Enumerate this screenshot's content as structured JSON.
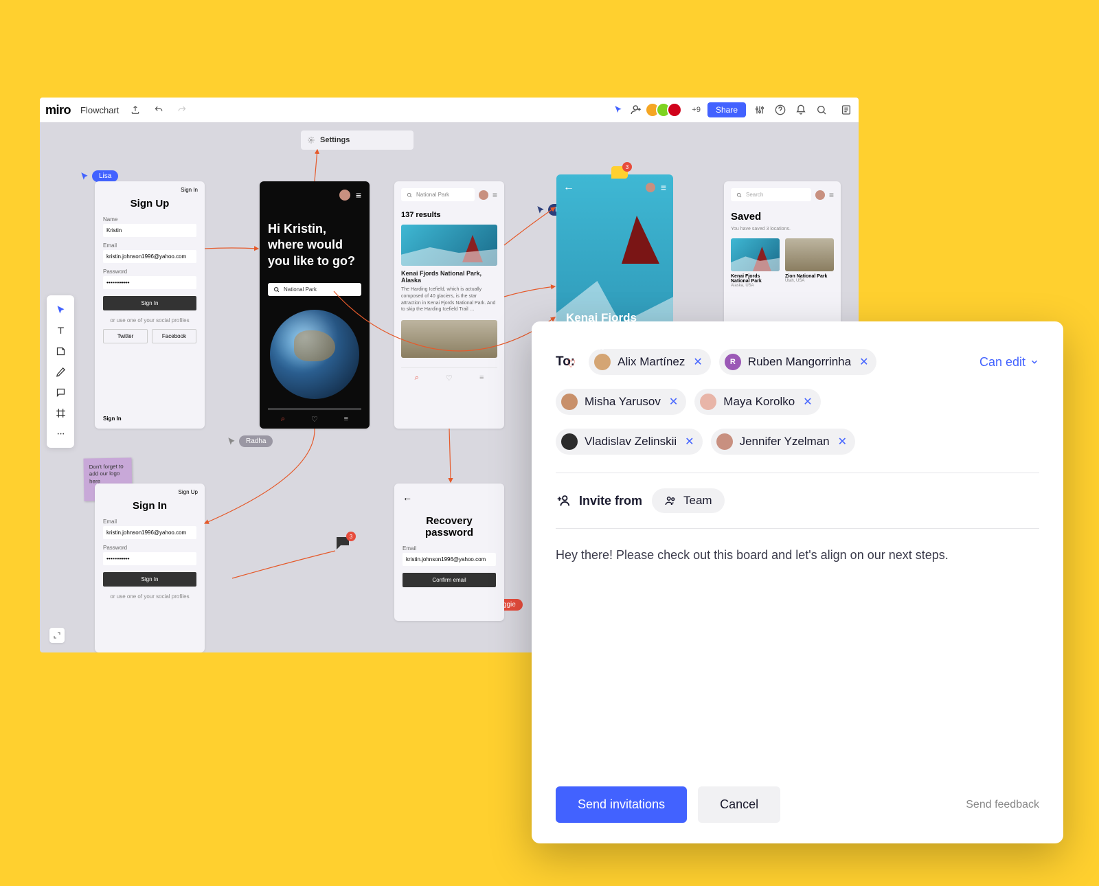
{
  "app": {
    "logo": "miro",
    "board_name": "Flowchart"
  },
  "topbar": {
    "share": "Share",
    "plus_count": "+9"
  },
  "settings": {
    "label": "Settings"
  },
  "cursors": {
    "lisa": "Lisa",
    "radha": "Radha",
    "maggie": "Maggie",
    "igor": "Igor"
  },
  "sticky": {
    "text": "Don't forget to add our logo here"
  },
  "mockups": {
    "signup": {
      "corner": "Sign In",
      "title": "Sign Up",
      "name_label": "Name",
      "name_value": "Kristin",
      "email_label": "Email",
      "email_value": "kristin.johnson1996@yahoo.com",
      "password_label": "Password",
      "password_value": "••••••••••••",
      "button": "Sign In",
      "or_text": "or use one of your social profiles",
      "twitter": "Twitter",
      "facebook": "Facebook",
      "bottom": "Sign In"
    },
    "signin": {
      "corner": "Sign Up",
      "title": "Sign In",
      "email_label": "Email",
      "email_value": "kristin.johnson1996@yahoo.com",
      "password_label": "Password",
      "password_value": "••••••••••••",
      "button": "Sign In",
      "or_text": "or use one of your social profiles"
    },
    "hello": {
      "greeting": "Hi Kristin, where would you like to go?",
      "search": "National Park"
    },
    "results": {
      "search": "National Park",
      "count": "137 results",
      "item_title": "Kenai Fjords National Park, Alaska",
      "item_desc": "The Harding Icefield, which is actually composed of 40 glaciers, is the star attraction in Kenai Fjords National Park. And to skip the Harding Icefield Trail …"
    },
    "detail": {
      "title": "Kenai Fjords National Park, Alaska",
      "badge": "3"
    },
    "recovery": {
      "title": "Recovery password",
      "email_label": "Email",
      "email_value": "kristin.johnson1996@yahoo.com",
      "button": "Confirm email"
    },
    "saved": {
      "search": "Search",
      "title": "Saved",
      "subtitle": "You have saved 3 locations.",
      "item1_title": "Kenai Fjords National Park",
      "item1_sub": "Alaska, USA",
      "item2_title": "Zion National Park",
      "item2_sub": "Utah, USA"
    },
    "comment_badge": "3"
  },
  "dialog": {
    "to_label": "To:",
    "can_edit": "Can edit",
    "chips": [
      {
        "name": "Alix Martínez",
        "color": "#d4a574"
      },
      {
        "name": "Ruben Mangorrinha",
        "color": "#9b59b6",
        "initial": "R"
      },
      {
        "name": "Misha Yarusov",
        "color": "#c8906a"
      },
      {
        "name": "Maya Korolko",
        "color": "#e8b5a8"
      },
      {
        "name": "Vladislav Zelinskii",
        "color": "#2c2c2c"
      },
      {
        "name": "Jennifer Yzelman",
        "color": "#c89080"
      }
    ],
    "invite_from": "Invite from",
    "team": "Team",
    "message": "Hey there! Please check out this board and let's align on our next steps.",
    "send": "Send invitations",
    "cancel": "Cancel",
    "feedback": "Send feedback"
  }
}
